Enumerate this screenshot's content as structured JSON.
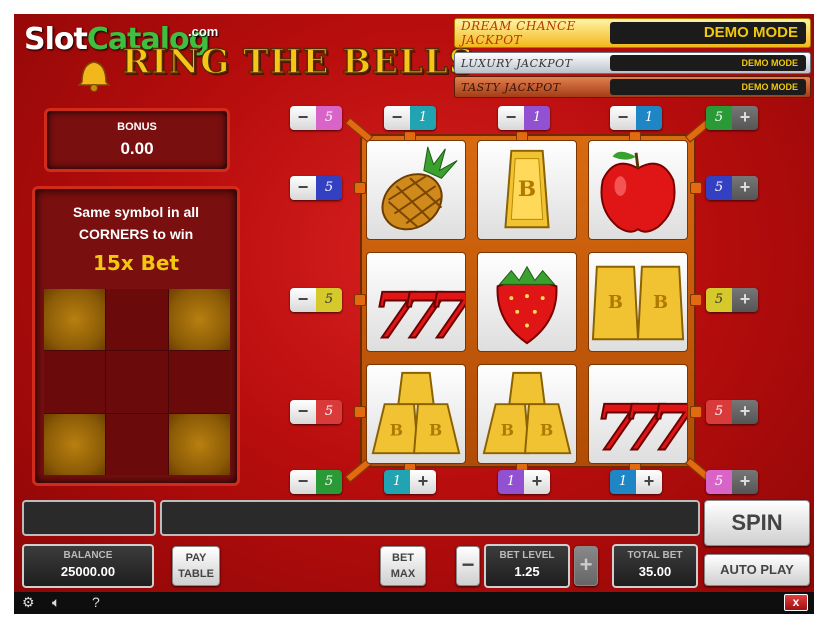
{
  "branding": {
    "logo_text_1": "Slot",
    "logo_text_2": "Catalog",
    "logo_suffix": ".com",
    "game_title": "RING THE BELLS"
  },
  "jackpots": [
    {
      "name": "DREAM CHANCE JACKPOT",
      "value": "DEMO MODE"
    },
    {
      "name": "LUXURY JACKPOT",
      "value": "DEMO MODE"
    },
    {
      "name": "TASTY JACKPOT",
      "value": "DEMO MODE"
    }
  ],
  "bonus": {
    "label": "BONUS",
    "value": "0.00"
  },
  "corners": {
    "text": "Same symbol in all CORNERS to win",
    "multiplier": "15x Bet"
  },
  "reels": [
    [
      "pineapple",
      "gold-bar",
      "apple"
    ],
    [
      "seven",
      "strawberry",
      "gold-bars"
    ],
    [
      "gold-stack",
      "gold-stack",
      "seven"
    ]
  ],
  "paylines": {
    "top": [
      "5",
      "1",
      "1",
      "1",
      "5"
    ],
    "left": [
      "5",
      "5",
      "5"
    ],
    "right": [
      "5",
      "5",
      "5"
    ],
    "bottom": [
      "5",
      "1",
      "1",
      "1",
      "5"
    ],
    "colors": {
      "pink": "#d964c8",
      "teal": "#22a3b1",
      "purple": "#9151d1",
      "green": "#2a9a36",
      "blue": "#3340c2",
      "yellow": "#d6c92c",
      "red": "#d93a3a",
      "cyan": "#1e86c4"
    }
  },
  "controls": {
    "spin": "SPIN",
    "autoplay": "AUTO PLAY",
    "pay_table_1": "PAY",
    "pay_table_2": "TABLE",
    "bet_max_1": "BET",
    "bet_max_2": "MAX",
    "minus": "−",
    "plus": "+",
    "balance_label": "BALANCE",
    "balance_value": "25000.00",
    "bet_level_label": "BET LEVEL",
    "bet_level_value": "1.25",
    "total_bet_label": "TOTAL BET",
    "total_bet_value": "35.00"
  },
  "footer": {
    "settings_icon": "gear-icon",
    "sound_icon": "speaker-icon",
    "help": "?",
    "close": "x"
  }
}
